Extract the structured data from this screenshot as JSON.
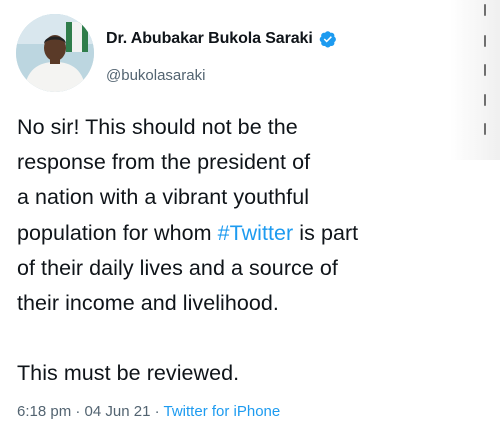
{
  "author": {
    "display_name": "Dr. Abubakar Bukola Saraki",
    "handle": "@bukolasaraki",
    "verified": true,
    "verified_icon": "verified-badge-icon",
    "verified_color": "#1d9bf0"
  },
  "tweet": {
    "line1": "No sir! This should not be the",
    "line2": "response from the president of",
    "line3": "a nation with a vibrant youthful",
    "line4_pre": "population for whom ",
    "hashtag": "#Twitter",
    "line4_post": " is part",
    "line5": "of their daily lives and a source of",
    "line6": "their income and livelihood.",
    "line7": "This must be reviewed."
  },
  "meta": {
    "time": "6:18 pm",
    "separator": "·",
    "date": "04 Jun 21",
    "source": "Twitter for iPhone"
  },
  "colors": {
    "text": "#0f1419",
    "secondary": "#536471",
    "link": "#1d9bf0"
  }
}
